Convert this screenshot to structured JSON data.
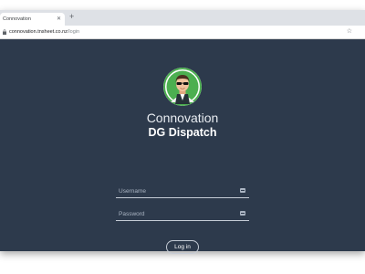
{
  "browser": {
    "tab_title": "Connovation",
    "tab_close_icon": "close-icon",
    "new_tab_icon": "plus-icon",
    "url_host": "connovation.tnsheet.co.nz",
    "url_path": "/login",
    "bookmark_icon": "star-icon"
  },
  "login": {
    "avatar_icon": "person-with-sunglasses-avatar",
    "brand": "Connovation",
    "app_title": "DG Dispatch",
    "username_placeholder": "Username",
    "password_placeholder": "Password",
    "field_icon": "keyboard-icon",
    "login_label": "Log in"
  },
  "colors": {
    "background": "#2d3a4c",
    "avatar_ring": "#4caf50",
    "text": "#ffffff"
  }
}
